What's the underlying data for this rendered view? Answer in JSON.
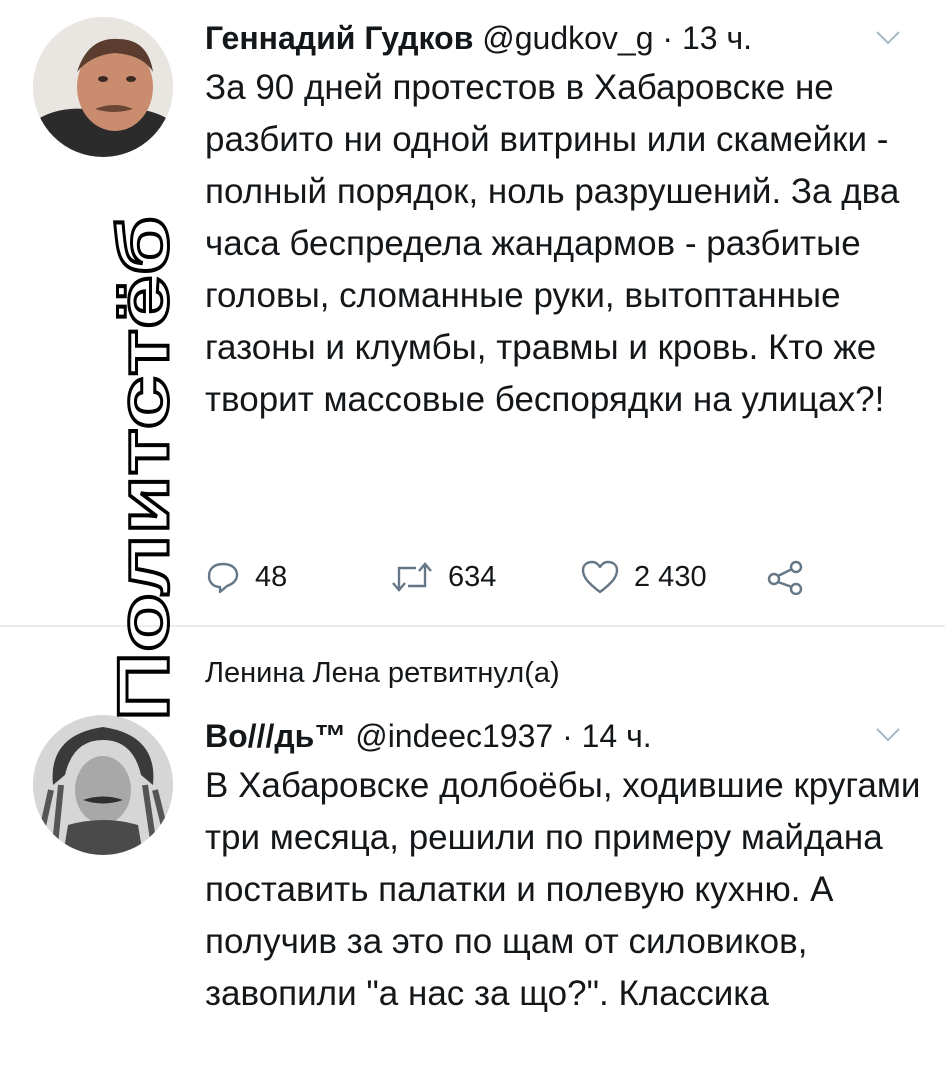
{
  "tweet1": {
    "author_name": "Геннадий Гудков",
    "handle": "@gudkov_g",
    "time": "· 13 ч.",
    "text": "За 90 дней протестов в Хабаровске не разбито ни одной витрины или скамейки - полный порядок, ноль разрушений. За два часа беспредела жандармов - разбитые головы, сломанные руки, вытоптанные газоны и клумбы, травмы и кровь. Кто же творит массовые беспорядки на улицах?!",
    "replies": "48",
    "retweets": "634",
    "likes": "2 430"
  },
  "retweet_notice": "Ленина Лена ретвитнул(а)",
  "tweet2": {
    "author_name": "Во///дь™",
    "handle": "@indeec1937",
    "time": "· 14 ч.",
    "text": "В Хабаровске долбоёбы, ходившие кругами три месяца, решили по примеру майдана поставить палатки и полевую кухню. А получив за это по щам от силовиков, завопили \"а нас за що?\". Классика"
  },
  "watermark": "Политстёб",
  "icons": [
    "reply-icon",
    "retweet-icon",
    "like-icon",
    "share-icon",
    "chevron-down-icon"
  ]
}
